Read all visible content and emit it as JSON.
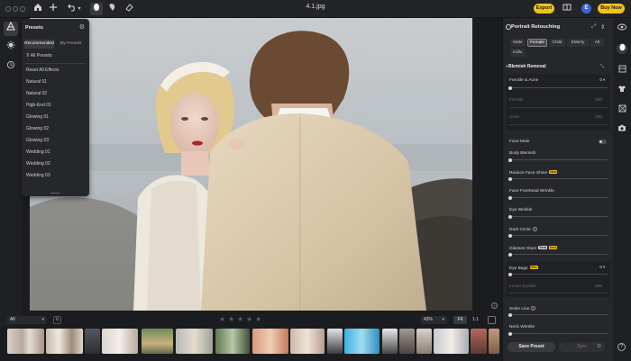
{
  "window": {
    "title": "4.1.jpg"
  },
  "header": {
    "export_label": "Export",
    "avatar_initial": "E",
    "buy_now_label": "Buy Now"
  },
  "presets": {
    "title": "Presets",
    "tabs": [
      "Recommended",
      "My Presets"
    ],
    "all_presets_label": "All Presets",
    "items": [
      "Reset All Effects",
      "Natural 01",
      "Natural 02",
      "High-End 01",
      "Glowing 01",
      "Glowing 02",
      "Glowing 03",
      "Wedding 01",
      "Wedding 02",
      "Wedding 03"
    ]
  },
  "bottom_toolbar": {
    "filter_value": "All",
    "zoom_value": "43%",
    "fit_label": "Fit",
    "one_to_one_label": "1:1",
    "rating_stars": 5
  },
  "right_panel": {
    "title": "Portrait Retouching",
    "gender_tabs": [
      "Male",
      "Female",
      "Child",
      "Elderly",
      "All"
    ],
    "indiv_tab": "Indiv.",
    "active_tab": "Female",
    "section_title": "Blemish Removal",
    "freckle_acne": {
      "label": "Freckle & Acne",
      "value": "0"
    },
    "freckle_sub": {
      "label": "Freckle",
      "value": "100"
    },
    "acne_sub": {
      "label": "Acne",
      "value": "100"
    },
    "face_mole": {
      "label": "Face Mole"
    },
    "body_blemish": {
      "label": "Body Blemish"
    },
    "reduce_face_shine": {
      "label": "Reduce Face Shine",
      "badge": "New"
    },
    "face_forehead_wrinkle": {
      "label": "Face Forehead Wrinkle"
    },
    "eye_wrinkle": {
      "label": "Eye Wrinkle"
    },
    "dark_circle": {
      "label": "Dark Circle"
    },
    "glasses_glare": {
      "label": "Glasses Glare",
      "badge1": "Beta",
      "badge2": "New"
    },
    "eye_bags": {
      "label": "Eye Bags",
      "badge": "New",
      "value": "0"
    },
    "lower_eyelids": {
      "label": "Lower Eyelids",
      "value": "100"
    },
    "smile_line": {
      "label": "Smile Line"
    },
    "neck_wrinkle": {
      "label": "Neck Wrinkle"
    },
    "save_preset_label": "Save Preset",
    "sync_label": "Sync"
  },
  "colors": {
    "accent": "#f2c318",
    "avatar": "#3a63d8",
    "panel": "#26272b"
  }
}
